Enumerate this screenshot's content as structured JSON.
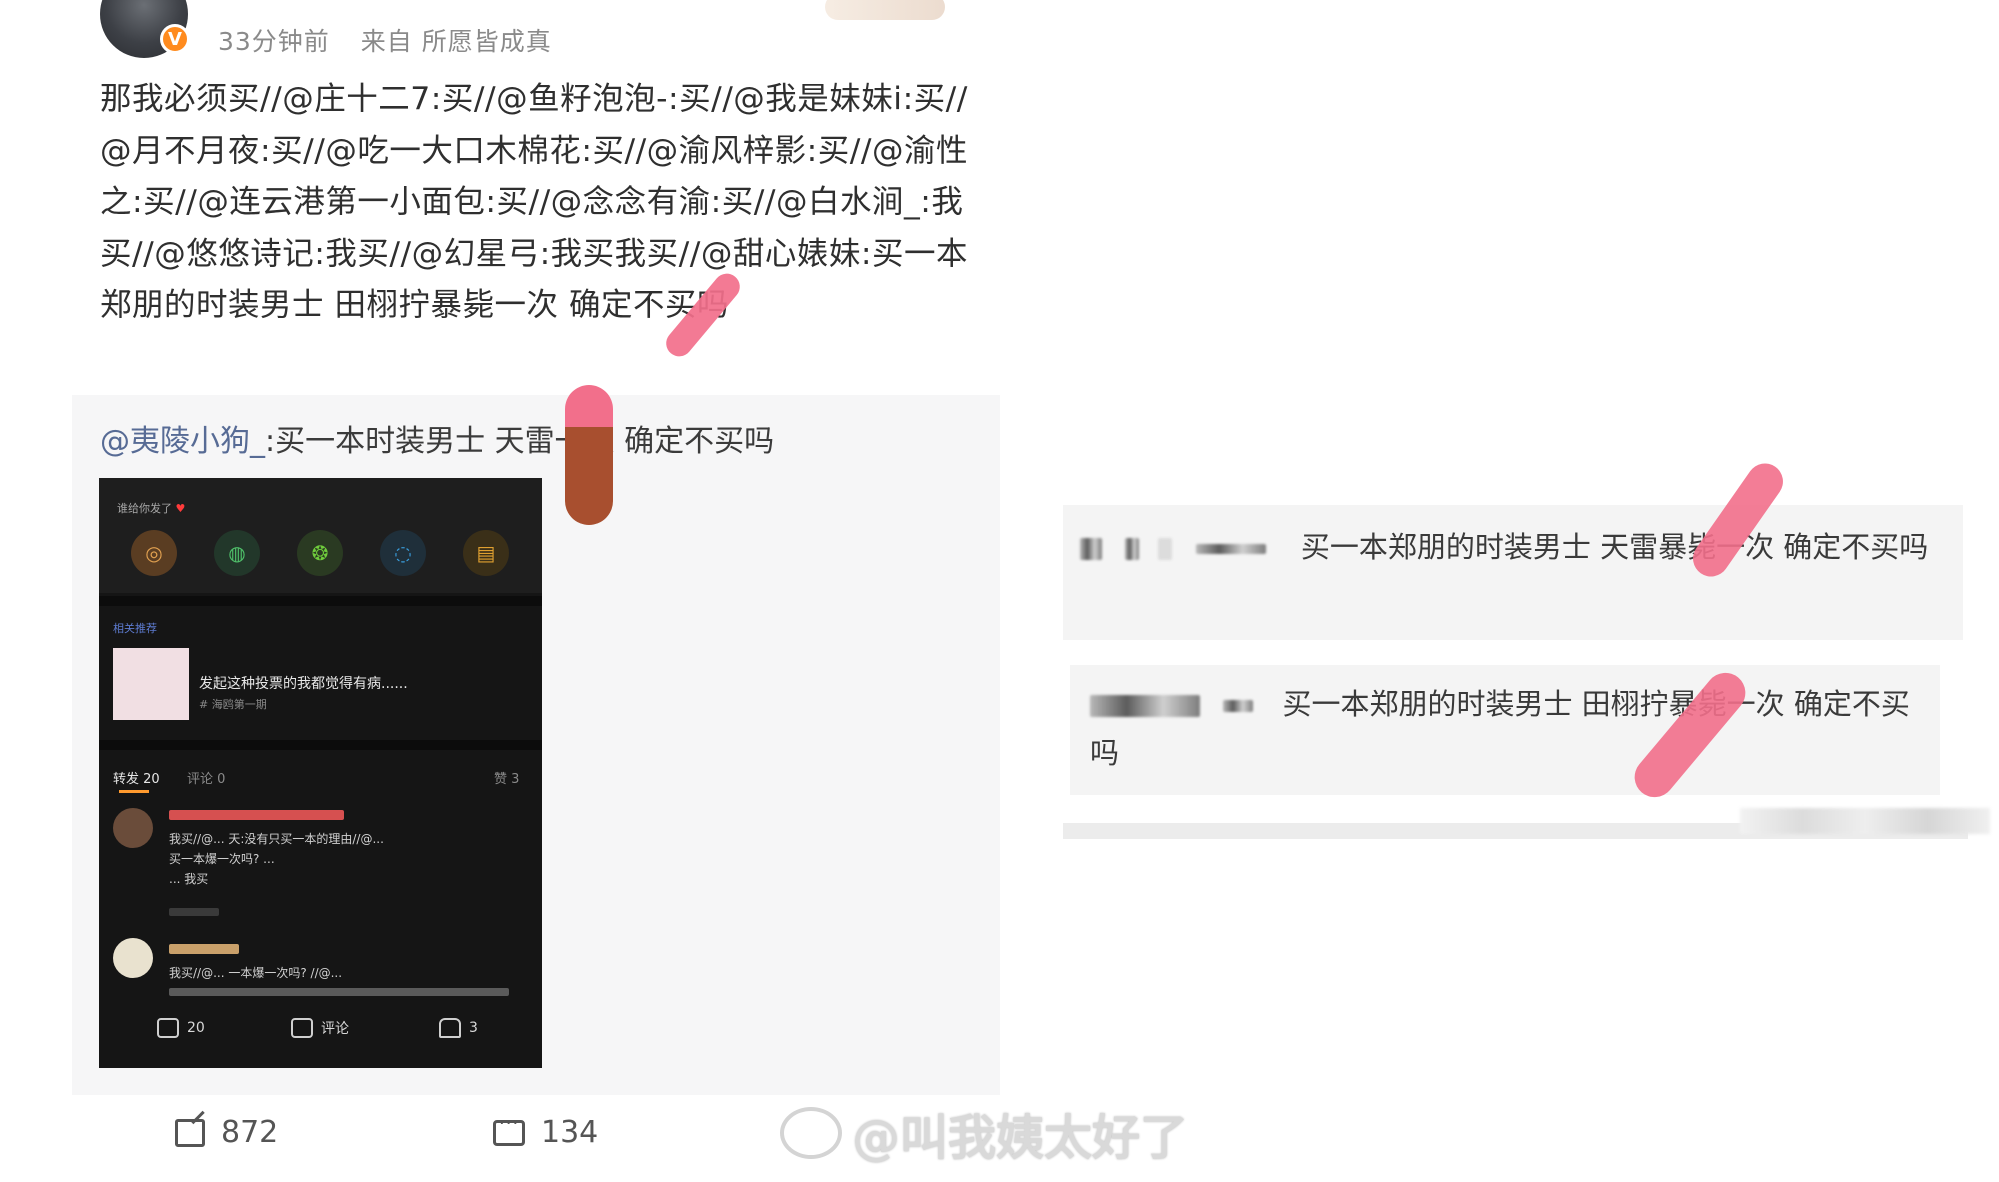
{
  "post": {
    "time": "33分钟前",
    "source": "来自 所愿皆成真",
    "text": "那我必须买//@庄十二7:买//@鱼籽泡泡-:买//@我是妹妹i:买//@月不月夜:买//@吃一大口木棉花:买//@渝风梓影:买//@渝性之:买//@连云港第一小面包:买//@念念有渝:买//@白水涧_:我买//@悠悠诗记:我买//@幻星弓:我买我买//@甜心婊妹:买一本郑朋的时装男士 田栩拧暴毙一次 确定不买吗"
  },
  "retweet": {
    "mention": "@夷陵小狗_",
    "text": ":买一本时装男士 天雷一次 确定不买吗"
  },
  "phone": {
    "title": "谁给你发了",
    "related_label": "相关推荐",
    "card_text": "发起这种投票的我都觉得有病......",
    "card_sub": "# 海鸥第一期",
    "tab_forward": "转发 20",
    "tab_comment": "评论 0",
    "tab_like": "赞 3",
    "row1_text": "我买//@... 天:没有只买一本的理由//@...",
    "row1_text2": "买一本爆一次吗? ...",
    "row1_text3": "... 我买",
    "row2_text": "我买//@... 一本爆一次吗? //@...",
    "foot_share": "20",
    "foot_comment": "评论",
    "foot_like": "3"
  },
  "actions": {
    "share_count": "872",
    "comment_count": "134"
  },
  "watermark": "@叫我姨太好了",
  "comments": [
    {
      "text": "买一本郑朋的时装男士 天雷暴毙一次 确定不买吗"
    },
    {
      "text": "买一本郑朋的时装男士 田栩拧暴毙一次 确定不买吗"
    }
  ],
  "colors": {
    "mention": "#576b95",
    "censor": "#f26f8b",
    "censor_brown": "#a84f2f"
  }
}
